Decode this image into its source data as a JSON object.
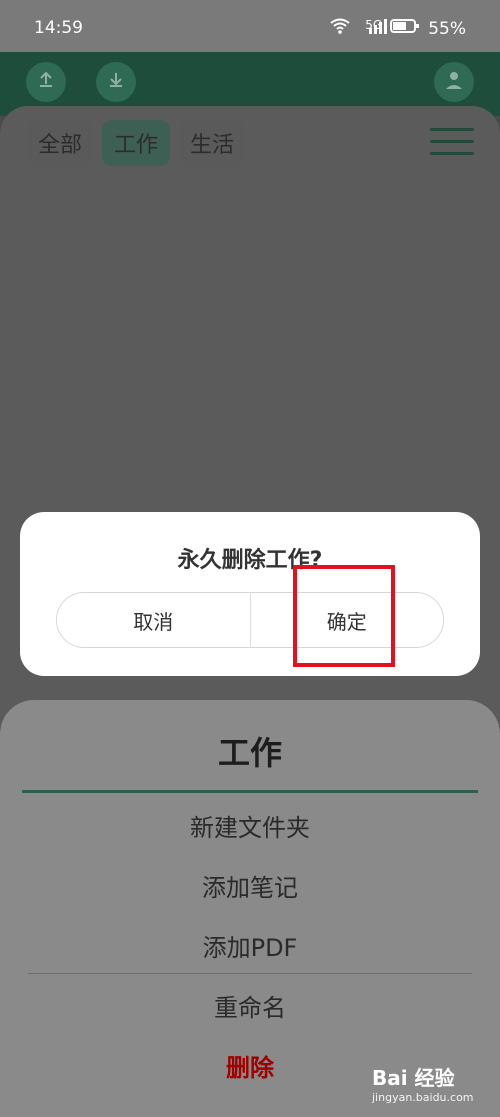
{
  "status_bar": {
    "time": "14:59",
    "network": "5G",
    "battery": "55%",
    "icons": [
      "wifi-icon",
      "signal-icon",
      "battery-icon"
    ]
  },
  "header": {
    "icons": [
      "upload-icon",
      "download-icon",
      "user-icon"
    ]
  },
  "tabs": {
    "items": [
      "全部",
      "工作",
      "生活"
    ],
    "active_index": 1
  },
  "dialog": {
    "title": "永久删除工作?",
    "cancel": "取消",
    "confirm": "确定"
  },
  "sheet": {
    "title": "工作",
    "items": [
      "新建文件夹",
      "添加笔记",
      "添加PDF",
      "重命名",
      "删除"
    ]
  },
  "watermark": {
    "brand": "Bai 经验",
    "url": "jingyan.baidu.com"
  },
  "colors": {
    "header_green": "#1f4d3c",
    "highlight_red": "#e3101f",
    "danger_red": "#a00000"
  }
}
